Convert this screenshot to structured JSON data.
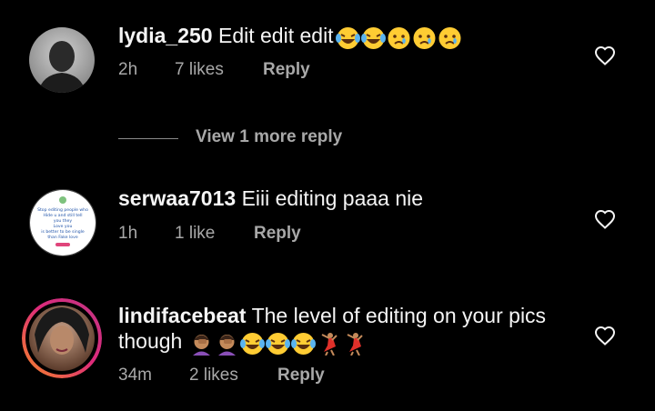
{
  "comments": [
    {
      "username": "lydia_250",
      "text": "Edit edit edit",
      "emojis": [
        "laughing-crying",
        "laughing-crying",
        "crying",
        "crying",
        "crying"
      ],
      "time": "2h",
      "likes": "7 likes",
      "reply_label": "Reply"
    },
    {
      "username": "serwaa7013",
      "text": "Eiii editing paaa nie",
      "emojis": [],
      "time": "1h",
      "likes": "1 like",
      "reply_label": "Reply"
    },
    {
      "username": "lindifacebeat",
      "text": "The level of editing on your pics",
      "text_line2": "though",
      "emojis": [
        "facepalm",
        "facepalm",
        "laughing-crying",
        "laughing-crying",
        "laughing-crying",
        "dancer",
        "dancer"
      ],
      "time": "34m",
      "likes": "2 likes",
      "reply_label": "Reply"
    }
  ],
  "view_more": {
    "label": "View 1 more reply"
  },
  "avatar2_text": {
    "line1": "Stop editing people who",
    "line2": "Hide u and still tell",
    "line3": "you they",
    "line4": "Love you",
    "line5": "is better to be single",
    "line6": "than Fake love"
  },
  "colors": {
    "background": "#000000",
    "text_primary": "#f5f5f5",
    "text_secondary": "#a8a8a8",
    "story_ring_start": "#f58529",
    "story_ring_end": "#dd2a7b"
  }
}
